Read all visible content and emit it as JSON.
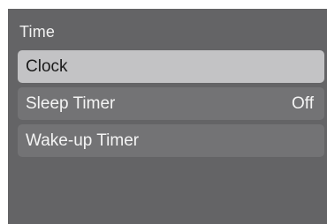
{
  "menu": {
    "title": "Time",
    "items": [
      {
        "label": "Clock",
        "value": "",
        "selected": true
      },
      {
        "label": "Sleep Timer",
        "value": "Off",
        "selected": false
      },
      {
        "label": "Wake-up Timer",
        "value": "",
        "selected": false
      }
    ]
  },
  "colors": {
    "panel_background": "#646466",
    "selected_item": "#c3c3c5",
    "item_background": "#737375",
    "text_light": "#f4f4f4",
    "text_dark": "#1b1b1b"
  }
}
